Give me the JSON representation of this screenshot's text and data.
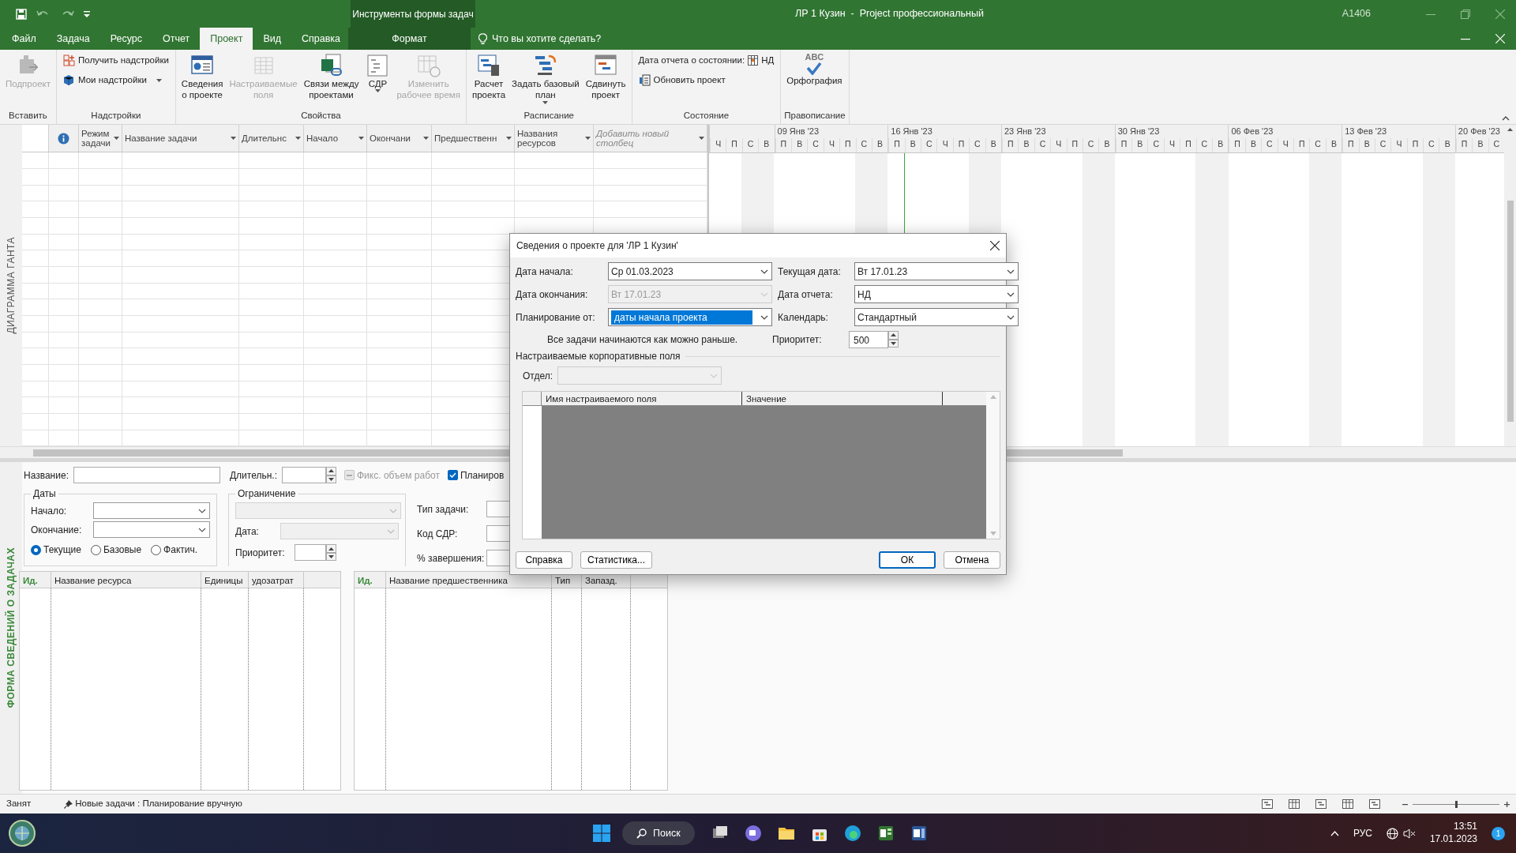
{
  "title_bar": {
    "context_title": "Инструменты формы задач",
    "title": "ЛР 1 Кузин  -  Project профессиональный",
    "user": "A1406"
  },
  "menu_tabs": [
    {
      "label": "Файл",
      "selected": false
    },
    {
      "label": "Задача",
      "selected": false
    },
    {
      "label": "Ресурс",
      "selected": false
    },
    {
      "label": "Отчет",
      "selected": false
    },
    {
      "label": "Проект",
      "selected": true
    },
    {
      "label": "Вид",
      "selected": false
    },
    {
      "label": "Справка",
      "selected": false
    }
  ],
  "context_tab": {
    "label": "Формат",
    "selected": false
  },
  "tell_me": "Что вы хотите сделать?",
  "ribbon_groups": [
    {
      "label": "Вставить",
      "buttons": [
        {
          "kind": "large",
          "label": "Подпроект",
          "disabled": true,
          "dropdown": false
        }
      ]
    },
    {
      "label": "Надстройки",
      "buttons": [
        {
          "kind": "small",
          "label": "Получить надстройки",
          "disabled": false,
          "dropdown": false
        },
        {
          "kind": "small",
          "label": "Мои надстройки",
          "disabled": false,
          "dropdown": true
        }
      ]
    },
    {
      "label": "Свойства",
      "buttons": [
        {
          "kind": "large",
          "label": "Сведения\nо проекте",
          "disabled": false,
          "dropdown": false
        },
        {
          "kind": "large",
          "label": "Настраиваемые\nполя",
          "disabled": true,
          "dropdown": false
        },
        {
          "kind": "large",
          "label": "Связи между\nпроектами",
          "disabled": false,
          "dropdown": false
        },
        {
          "kind": "large",
          "label": "СДР",
          "disabled": false,
          "dropdown": true
        },
        {
          "kind": "large",
          "label": "Изменить\nрабочее время",
          "disabled": true,
          "dropdown": false
        }
      ]
    },
    {
      "label": "Расписание",
      "buttons": [
        {
          "kind": "large",
          "label": "Расчет\nпроекта",
          "disabled": false,
          "dropdown": false
        },
        {
          "kind": "large",
          "label": "Задать базовый\nплан",
          "disabled": false,
          "dropdown": true
        },
        {
          "kind": "large",
          "label": "Сдвинуть\nпроект",
          "disabled": false,
          "dropdown": false
        }
      ]
    },
    {
      "label": "Состояние",
      "buttons": [
        {
          "kind": "status",
          "label": "Дата отчета о состоянии:",
          "value": "НД",
          "disabled": false,
          "dropdown": false
        },
        {
          "kind": "small",
          "label": "Обновить проект",
          "disabled": false,
          "dropdown": false
        }
      ]
    },
    {
      "label": "Правописание",
      "buttons": [
        {
          "kind": "spell",
          "icon_text": "ABC",
          "label": "Орфография",
          "disabled": false,
          "dropdown": false
        }
      ]
    }
  ],
  "side_label_top": "ДИАГРАММА ГАНТА",
  "task_table": {
    "columns": [
      {
        "kind": "info"
      },
      {
        "kind": "field",
        "label": "Режим задачи"
      },
      {
        "kind": "field",
        "label": "Название задачи"
      },
      {
        "kind": "field",
        "label": "Длительнс"
      },
      {
        "kind": "field",
        "label": "Начало"
      },
      {
        "kind": "field",
        "label": "Окончани"
      },
      {
        "kind": "field",
        "label": "Предшественн"
      },
      {
        "kind": "field",
        "label": "Названия ресурсов"
      },
      {
        "kind": "add",
        "label": "Добавить новый столбец"
      }
    ]
  },
  "gantt": {
    "weeks": [
      {
        "days": [
          {
            "letter": "Ч",
            "weekend": false,
            "today": false
          },
          {
            "letter": "П",
            "weekend": false,
            "today": false
          },
          {
            "letter": "С",
            "weekend": true,
            "today": false
          },
          {
            "letter": "В",
            "weekend": true,
            "today": false
          }
        ]
      },
      {
        "label": "09 Янв '23",
        "days": [
          {
            "letter": "П",
            "weekend": false,
            "today": false
          },
          {
            "letter": "В",
            "weekend": false,
            "today": false
          },
          {
            "letter": "С",
            "weekend": false,
            "today": false
          },
          {
            "letter": "Ч",
            "weekend": false,
            "today": false
          },
          {
            "letter": "П",
            "weekend": false,
            "today": false
          },
          {
            "letter": "С",
            "weekend": true,
            "today": false
          },
          {
            "letter": "В",
            "weekend": true,
            "today": false
          }
        ]
      },
      {
        "label": "16 Янв '23",
        "days": [
          {
            "letter": "П",
            "weekend": false,
            "today": false
          },
          {
            "letter": "В",
            "weekend": false,
            "today": true
          },
          {
            "letter": "С",
            "weekend": false,
            "today": false
          },
          {
            "letter": "Ч",
            "weekend": false,
            "today": false
          },
          {
            "letter": "П",
            "weekend": false,
            "today": false
          },
          {
            "letter": "С",
            "weekend": true,
            "today": false
          },
          {
            "letter": "В",
            "weekend": true,
            "today": false
          }
        ]
      },
      {
        "label": "23 Янв '23",
        "days": [
          {
            "letter": "П",
            "weekend": false,
            "today": false
          },
          {
            "letter": "В",
            "weekend": false,
            "today": false
          },
          {
            "letter": "С",
            "weekend": false,
            "today": false
          },
          {
            "letter": "Ч",
            "weekend": false,
            "today": false
          },
          {
            "letter": "П",
            "weekend": false,
            "today": false
          },
          {
            "letter": "С",
            "weekend": true,
            "today": false
          },
          {
            "letter": "В",
            "weekend": true,
            "today": false
          }
        ]
      },
      {
        "label": "30 Янв '23",
        "days": [
          {
            "letter": "П",
            "weekend": false,
            "today": false
          },
          {
            "letter": "В",
            "weekend": false,
            "today": false
          },
          {
            "letter": "С",
            "weekend": false,
            "today": false
          },
          {
            "letter": "Ч",
            "weekend": false,
            "today": false
          },
          {
            "letter": "П",
            "weekend": false,
            "today": false
          },
          {
            "letter": "С",
            "weekend": true,
            "today": false
          },
          {
            "letter": "В",
            "weekend": true,
            "today": false
          }
        ]
      },
      {
        "label": "06 Фев '23",
        "days": [
          {
            "letter": "П",
            "weekend": false,
            "today": false
          },
          {
            "letter": "В",
            "weekend": false,
            "today": false
          },
          {
            "letter": "С",
            "weekend": false,
            "today": false
          },
          {
            "letter": "Ч",
            "weekend": false,
            "today": false
          },
          {
            "letter": "П",
            "weekend": false,
            "today": false
          },
          {
            "letter": "С",
            "weekend": true,
            "today": false
          },
          {
            "letter": "В",
            "weekend": true,
            "today": false
          }
        ]
      },
      {
        "label": "13 Фев '23",
        "days": [
          {
            "letter": "П",
            "weekend": false,
            "today": false
          },
          {
            "letter": "В",
            "weekend": false,
            "today": false
          },
          {
            "letter": "С",
            "weekend": false,
            "today": false
          },
          {
            "letter": "Ч",
            "weekend": false,
            "today": false
          },
          {
            "letter": "П",
            "weekend": false,
            "today": false
          },
          {
            "letter": "С",
            "weekend": true,
            "today": false
          },
          {
            "letter": "В",
            "weekend": true,
            "today": false
          }
        ]
      },
      {
        "label": "20 Фев '23",
        "days": [
          {
            "letter": "П",
            "weekend": false,
            "today": false
          },
          {
            "letter": "В",
            "weekend": false,
            "today": false
          },
          {
            "letter": "С",
            "weekend": false,
            "today": false
          }
        ]
      }
    ]
  },
  "side_label_bottom": "ФОРМА СВЕДЕНИЙ О ЗАДАЧАХ",
  "task_form": {
    "name_label": "Название:",
    "duration_label": "Длительн.:",
    "checks": [
      {
        "label": "Фикс. объем работ",
        "checked": false,
        "disabled": true
      },
      {
        "label": "Планиров",
        "checked": true,
        "disabled": false
      }
    ],
    "dates": {
      "title": "Даты",
      "start_label": "Начало:",
      "end_label": "Окончание:",
      "radios": [
        {
          "label": "Текущие",
          "selected": true
        },
        {
          "label": "Базовые",
          "selected": false
        },
        {
          "label": "Фактич.",
          "selected": false
        }
      ]
    },
    "constraint": {
      "title": "Ограничение",
      "date_label": "Дата:",
      "priority_label": "Приоритет:",
      "disabled": true
    },
    "right_labels": [
      "Тип задачи:",
      "Код СДР:",
      "% завершения:"
    ],
    "resource_table": {
      "columns": [
        "Ид.",
        "Название ресурса",
        "Единицы",
        "удозатрат"
      ]
    },
    "predecessor_table": {
      "columns": [
        "Ид.",
        "Название предшественника",
        "Тип",
        "Запазд."
      ]
    }
  },
  "dialog": {
    "title": "Сведения о проекте для 'ЛР 1 Кузин'",
    "fields": [
      {
        "label": "Дата начала:",
        "value": "Ср 01.03.2023",
        "disabled": false,
        "highlighted": false
      },
      {
        "label": "Текущая дата:",
        "value": "Вт 17.01.23",
        "disabled": false,
        "highlighted": false
      },
      {
        "label": "Дата окончания:",
        "value": "Вт 17.01.23",
        "disabled": true,
        "highlighted": false
      },
      {
        "label": "Дата отчета:",
        "value": "НД",
        "disabled": false,
        "highlighted": false
      },
      {
        "label": "Планирование от:",
        "value": "даты начала проекта",
        "disabled": false,
        "highlighted": true
      },
      {
        "label": "Календарь:",
        "value": "Стандартный",
        "disabled": false,
        "highlighted": false
      }
    ],
    "note": "Все задачи начинаются как можно раньше.",
    "priority": {
      "label": "Приоритет:",
      "value": "500"
    },
    "enterprise_title": "Настраиваемые корпоративные поля",
    "department": {
      "label": "Отдел:",
      "disabled": true
    },
    "grid_columns": [
      "Имя настраиваемого поля",
      "Значение"
    ],
    "buttons": [
      {
        "label": "Справка",
        "default": false
      },
      {
        "label": "Статистика...",
        "default": false
      },
      {
        "label": "ОК",
        "default": true
      },
      {
        "label": "Отмена",
        "default": false
      }
    ]
  },
  "status_bar": {
    "state": "Занят",
    "new_tasks": "Новые задачи : Планирование вручную",
    "zoom": {
      "level": 0.5
    }
  },
  "taskbar": {
    "search": "Поиск",
    "language": "РУС",
    "time": "13:51",
    "date": "17.01.2023",
    "notifications": "1"
  }
}
